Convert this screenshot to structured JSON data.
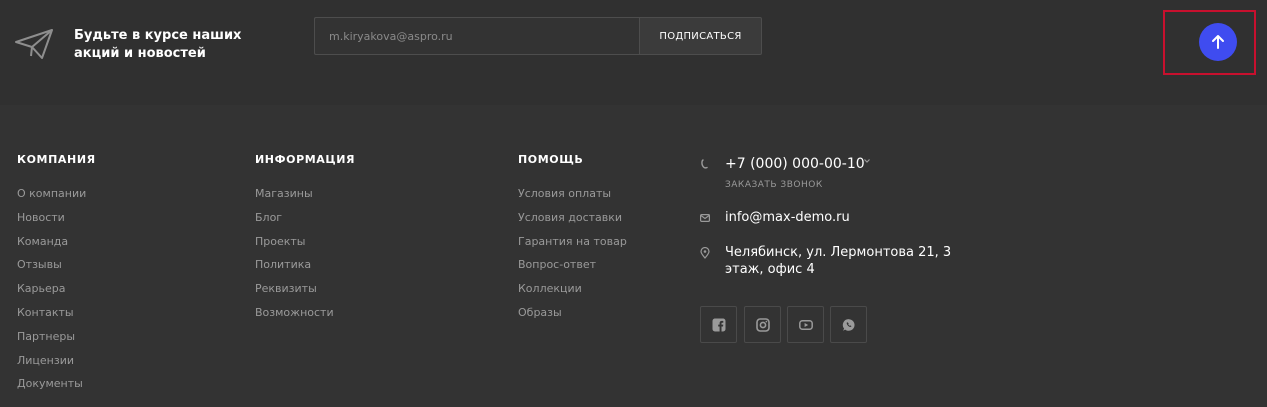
{
  "subscribe": {
    "text": "Будьте в курсе наших акций и новостей",
    "email_value": "m.kiryakova@aspro.ru",
    "button_label": "ПОДПИСАТЬСЯ"
  },
  "columns": [
    {
      "title": "КОМПАНИЯ",
      "items": [
        "О компании",
        "Новости",
        "Команда",
        "Отзывы",
        "Карьера",
        "Контакты",
        "Партнеры",
        "Лицензии",
        "Документы"
      ]
    },
    {
      "title": "ИНФОРМАЦИЯ",
      "items": [
        "Магазины",
        "Блог",
        "Проекты",
        "Политика",
        "Реквизиты",
        "Возможности"
      ]
    },
    {
      "title": "ПОМОЩЬ",
      "items": [
        "Условия оплаты",
        "Условия доставки",
        "Гарантия на товар",
        "Вопрос-ответ",
        "Коллекции",
        "Образы"
      ]
    }
  ],
  "contacts": {
    "phone": "+7 (000) 000-00-10",
    "callback": "ЗАКАЗАТЬ ЗВОНОК",
    "email": "info@max-demo.ru",
    "address": "Челябинск, ул. Лермонтова 21, 3 этаж, офис 4"
  },
  "socials": [
    "facebook-icon",
    "instagram-icon",
    "youtube-icon",
    "whatsapp-icon"
  ],
  "colors": {
    "background": "#333333",
    "subscribe_bar": "#303030",
    "accent": "#3f4cf0",
    "highlight_frame": "#c8102e",
    "muted_text": "#9a9a9a"
  }
}
